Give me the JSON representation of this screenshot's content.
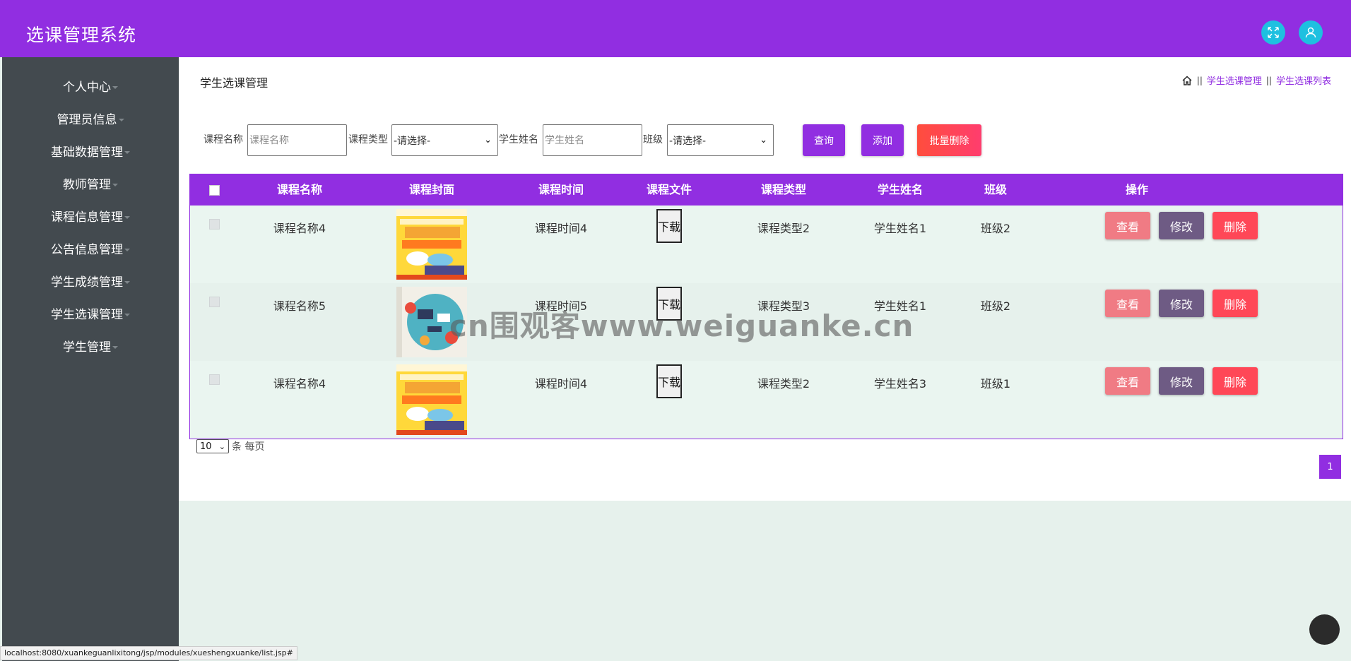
{
  "header": {
    "title": "选课管理系统"
  },
  "sidebar": {
    "items": [
      {
        "label": "个人中心"
      },
      {
        "label": "管理员信息"
      },
      {
        "label": "基础数据管理"
      },
      {
        "label": "教师管理"
      },
      {
        "label": "课程信息管理"
      },
      {
        "label": "公告信息管理"
      },
      {
        "label": "学生成绩管理"
      },
      {
        "label": "学生选课管理"
      },
      {
        "label": "学生管理"
      }
    ]
  },
  "page": {
    "title": "学生选课管理",
    "breadcrumb": [
      "学生选课管理",
      "学生选课列表"
    ],
    "breadcrumb_sep": "||"
  },
  "search": {
    "course_name_label": "课程名称",
    "course_name_placeholder": "课程名称",
    "course_type_label": "课程类型",
    "course_type_value": "-请选择-",
    "student_name_label": "学生姓名",
    "student_name_placeholder": "学生姓名",
    "class_label": "班级",
    "class_value": "-请选择-",
    "query_label": "查询",
    "add_label": "添加",
    "batch_delete_label": "批量删除"
  },
  "table": {
    "headers": [
      "课程名称",
      "课程封面",
      "课程时间",
      "课程文件",
      "课程类型",
      "学生姓名",
      "班级",
      "操作"
    ],
    "download_label": "下载",
    "view_label": "查看",
    "edit_label": "修改",
    "delete_label": "删除",
    "rows": [
      {
        "name": "课程名称4",
        "cover": "book",
        "time": "课程时间4",
        "type": "课程类型2",
        "student": "学生姓名1",
        "class": "班级2"
      },
      {
        "name": "课程名称5",
        "cover": "illustration",
        "time": "课程时间5",
        "type": "课程类型3",
        "student": "学生姓名1",
        "class": "班级2"
      },
      {
        "name": "课程名称4",
        "cover": "book",
        "time": "课程时间4",
        "type": "课程类型2",
        "student": "学生姓名3",
        "class": "班级1"
      }
    ]
  },
  "pagination": {
    "page_size": "10",
    "page_size_suffix": "条 每页",
    "current_page": "1"
  },
  "watermark": "cn围观客www.weiguanke.cn",
  "status_url": "localhost:8080/xuankeguanlixitong/jsp/modules/xueshengxuanke/list.jsp#",
  "colors": {
    "primary": "#912ee1",
    "sidebar": "#434a4f",
    "view_button": "#f07b84",
    "edit_button": "#6e5b84",
    "delete_button": "#ff4757",
    "top_icon": "#1ec0e0"
  }
}
